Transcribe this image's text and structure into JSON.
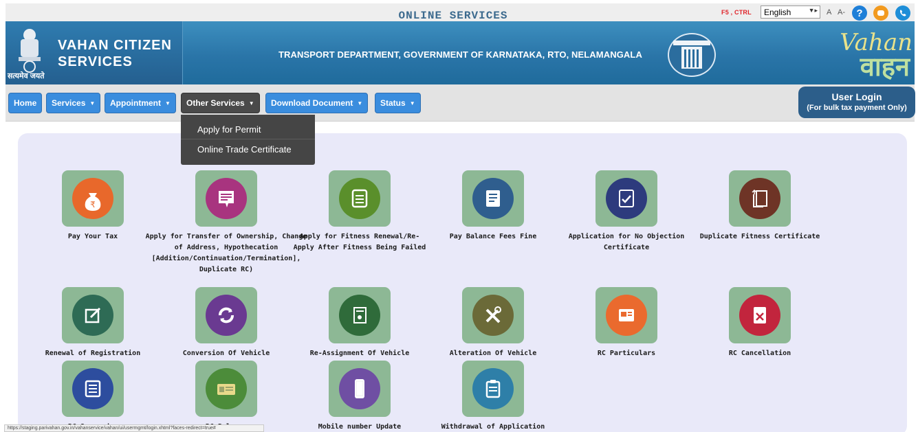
{
  "utility": {
    "shortcut": "F5 , CTRL",
    "language": "English",
    "font_small": "A",
    "font_smaller": "A-"
  },
  "header": {
    "title_line1": "VAHAN CITIZEN",
    "title_line2": "SERVICES",
    "emblem_caption": "सत्यमेव जयते",
    "department": "TRANSPORT DEPARTMENT, GOVERNMENT OF KARNATAKA, RTO, NELAMANGALA",
    "vahan_line1": "Vahan",
    "vahan_line2": "वाहन"
  },
  "nav": {
    "home": "Home",
    "services": "Services",
    "appointment": "Appointment",
    "other_services": "Other Services",
    "download_document": "Download Document",
    "status": "Status",
    "login_line1": "User Login",
    "login_line2": "(For bulk tax payment Only)"
  },
  "dropdown": {
    "items": [
      "Apply for Permit",
      "Online Trade Certificate"
    ]
  },
  "panel": {
    "title": "ONLINE SERVICES",
    "services": [
      {
        "label": "Pay Your Tax",
        "icon": "money-bag-icon",
        "color": "#e8682b"
      },
      {
        "label": "Apply for Transfer of Ownership, Change of Address, Hypothecation [Addition/Continuation/Termination], Duplicate RC)",
        "icon": "document-transfer-icon",
        "color": "#a8347f"
      },
      {
        "label": "Apply for Fitness Renewal/Re-Apply After Fitness Being Failed",
        "icon": "document-list-icon",
        "color": "#5a8f2b"
      },
      {
        "label": "Pay Balance Fees Fine",
        "icon": "receipt-icon",
        "color": "#2f5e8e"
      },
      {
        "label": "Application for No Objection Certificate",
        "icon": "certificate-check-icon",
        "color": "#2d3b7d"
      },
      {
        "label": "Duplicate Fitness Certificate",
        "icon": "duplicate-document-icon",
        "color": "#6e3426"
      },
      {
        "label": "Renewal of Registration",
        "icon": "edit-icon",
        "color": "#2e6b55"
      },
      {
        "label": "Conversion Of Vehicle",
        "icon": "refresh-icon",
        "color": "#6a3a91"
      },
      {
        "label": "Re-Assignment Of Vehicle",
        "icon": "reassign-document-icon",
        "color": "#2f6b3a"
      },
      {
        "label": "Alteration Of Vehicle",
        "icon": "tools-icon",
        "color": "#6b6a38"
      },
      {
        "label": "RC Particulars",
        "icon": "rc-details-icon",
        "color": "#ea6a2e"
      },
      {
        "label": "RC Cancellation",
        "icon": "cancel-document-icon",
        "color": "#c2253d"
      },
      {
        "label": "RC Surrender",
        "icon": "surrender-document-icon",
        "color": "#2d4d9e"
      },
      {
        "label": "RC Release",
        "icon": "rc-card-icon",
        "color": "#4c8c3a"
      },
      {
        "label": "Mobile number Update",
        "icon": "mobile-phone-icon",
        "color": "#6f4fa3"
      },
      {
        "label": "Withdrawal of Application",
        "icon": "clipboard-icon",
        "color": "#2e7fa8"
      }
    ]
  },
  "status_url": "https://staging.parivahan.gov.in/vahanservice/vahan/ui/usermgmt/login.xhtml?faces-redirect=true#"
}
